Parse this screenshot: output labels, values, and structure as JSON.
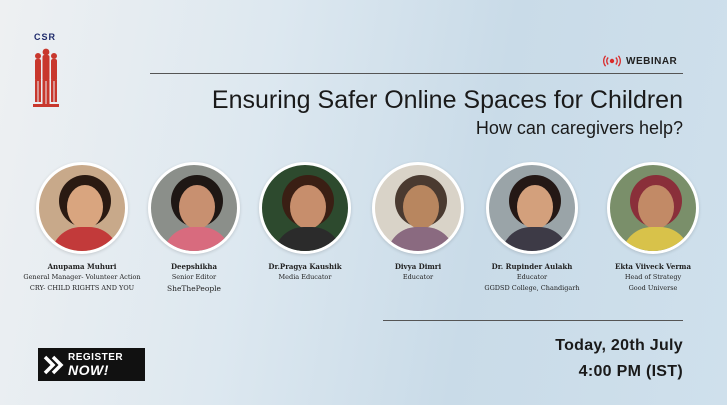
{
  "logo": {
    "text": "CSR",
    "icon": "people-group-logo-icon",
    "color": "#c8372d"
  },
  "badge": {
    "label": "WEBINAR",
    "icon": "live-broadcast-icon",
    "color": "#d92b2b"
  },
  "title": "Ensuring Safer Online Spaces for Children",
  "subtitle": "How can caregivers help?",
  "speakers": [
    {
      "name": "Anupama Muhuri",
      "role1": "General Manager- Volunteer Action",
      "role2": "CRY- CHILD RIGHTS AND YOU",
      "role3": ""
    },
    {
      "name": "Deepshikha",
      "role1": "Senior Editor",
      "role2": "SheThePeople",
      "role3": ""
    },
    {
      "name": "Dr.Pragya Kaushik",
      "role1": "Media Educator",
      "role2": "",
      "role3": ""
    },
    {
      "name": "Divya Dimri",
      "role1": "Educator",
      "role2": "",
      "role3": ""
    },
    {
      "name": "Dr. Rupinder Aulakh",
      "role1": "Educator",
      "role2": "GGDSD College, Chandigarh",
      "role3": ""
    },
    {
      "name": "Ekta Viiveck Verma",
      "role1": "Head of Strategy",
      "role2": "Good Universe",
      "role3": ""
    }
  ],
  "register": {
    "line1": "REGISTER",
    "line2": "NOW!",
    "icon": "double-chevron-right-icon"
  },
  "schedule": {
    "date": "Today, 20th July",
    "time": "4:00 PM (IST)"
  }
}
